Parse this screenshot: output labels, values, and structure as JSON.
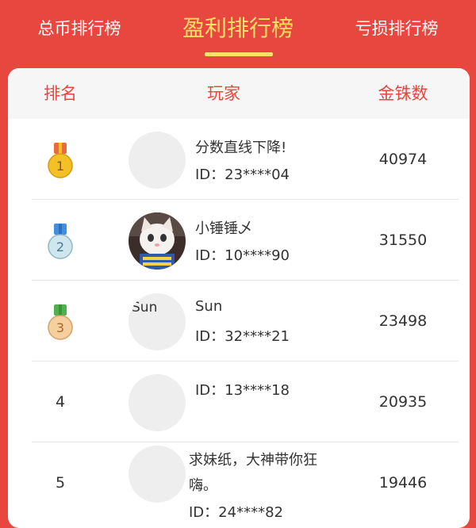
{
  "tabs": [
    {
      "label": "总币排行榜"
    },
    {
      "label": "盈利排行榜"
    },
    {
      "label": "亏损排行榜"
    }
  ],
  "table": {
    "headers": {
      "rank": "排名",
      "player": "玩家",
      "gold": "金铢数"
    }
  },
  "rows": [
    {
      "rank": "1",
      "medal_color": "#f3c025",
      "ribbon_color": "#ea6a3c",
      "name": "分数直线下降!",
      "id": "ID：23****04",
      "gold": "40974",
      "avatar_text": ""
    },
    {
      "rank": "2",
      "medal_color": "#cfe6ef",
      "ribbon_color": "#3f8fe5",
      "name": "小锤锤乄",
      "id": "ID：10****90",
      "gold": "31550",
      "avatar_text": ""
    },
    {
      "rank": "3",
      "medal_color": "#f6cf9e",
      "ribbon_color": "#4fb14c",
      "name": "Sun",
      "id": "ID：32****21",
      "gold": "23498",
      "avatar_text": "Sun"
    },
    {
      "rank": "4",
      "name": "",
      "id": "ID：13****18",
      "gold": "20935",
      "avatar_text": ""
    },
    {
      "rank": "5",
      "name_line1": "求妹纸，大神带你狂",
      "name_line2": "嗨。",
      "id": "ID：24****82",
      "gold": "19446",
      "avatar_text": ""
    }
  ]
}
